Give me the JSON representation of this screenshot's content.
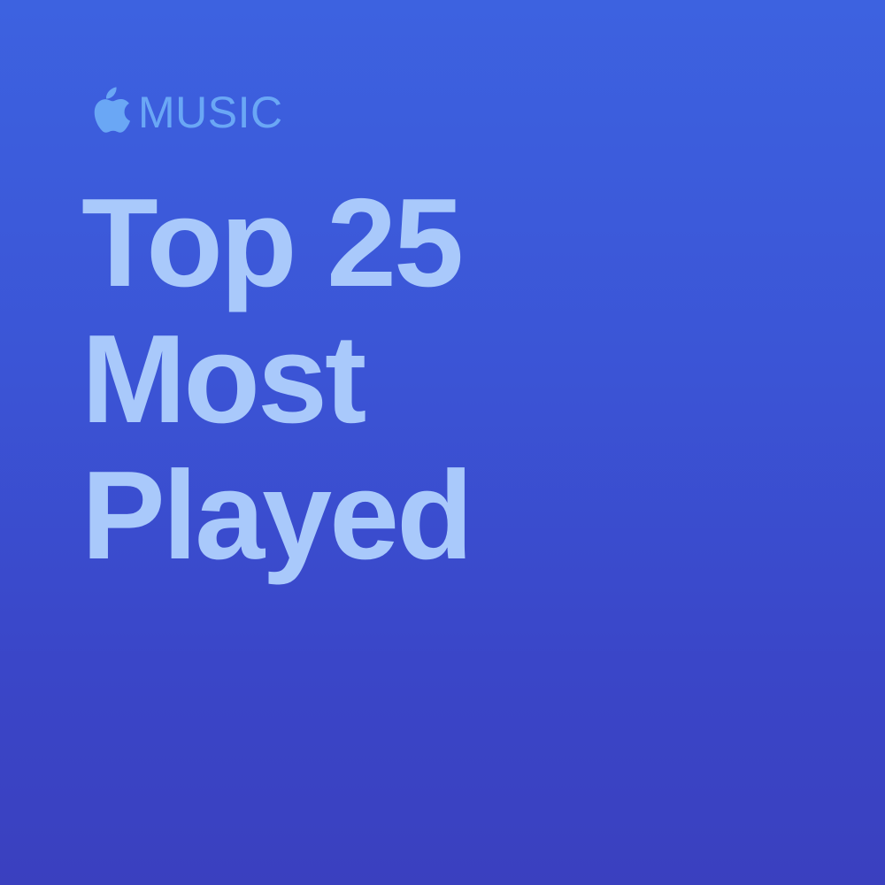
{
  "brand": {
    "logo_icon": "apple-logo-icon",
    "label": "MUSIC"
  },
  "title": {
    "lines": [
      "Top 25",
      "Most",
      "Played"
    ]
  },
  "colors": {
    "background_top": "#3d62e0",
    "background_bottom": "#3a40bf",
    "brand": "#6aa7f5",
    "title": "#a9c9fb"
  }
}
